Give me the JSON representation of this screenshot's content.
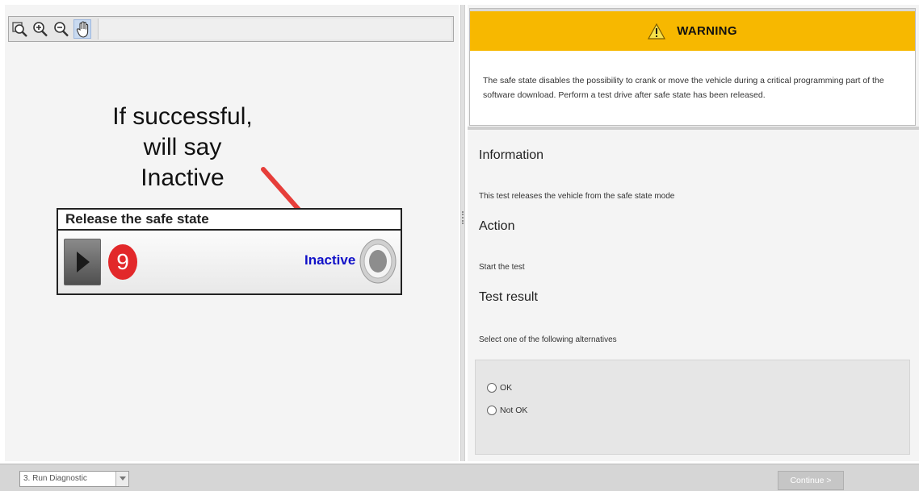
{
  "toolbar": {
    "icons": [
      "zoom-to-fit-icon",
      "zoom-in-icon",
      "zoom-out-icon",
      "pan-hand-icon"
    ]
  },
  "annotation": {
    "lines": [
      "If successful,",
      "will say",
      "Inactive"
    ],
    "arrow_color": "#e63e3a"
  },
  "step": {
    "title": "Release the safe state",
    "number": "9",
    "status": "Inactive",
    "number_color": "#e2282a",
    "status_color": "#1010c8"
  },
  "warning": {
    "title": "WARNING",
    "text": "The safe state disables the possibility to crank or move the vehicle during a critical programming part of the software download. Perform a test drive after safe state has been released.",
    "color": "#f7b800"
  },
  "information": {
    "heading": "Information",
    "text": "This test releases the vehicle from the safe state mode"
  },
  "action": {
    "heading": "Action",
    "text": "Start the test"
  },
  "result": {
    "heading": "Test result",
    "text": "Select one of the following alternatives",
    "options": [
      "OK",
      "Not OK"
    ]
  },
  "footer": {
    "step_select": "3. Run Diagnostic",
    "continue_label": "Continue >"
  }
}
